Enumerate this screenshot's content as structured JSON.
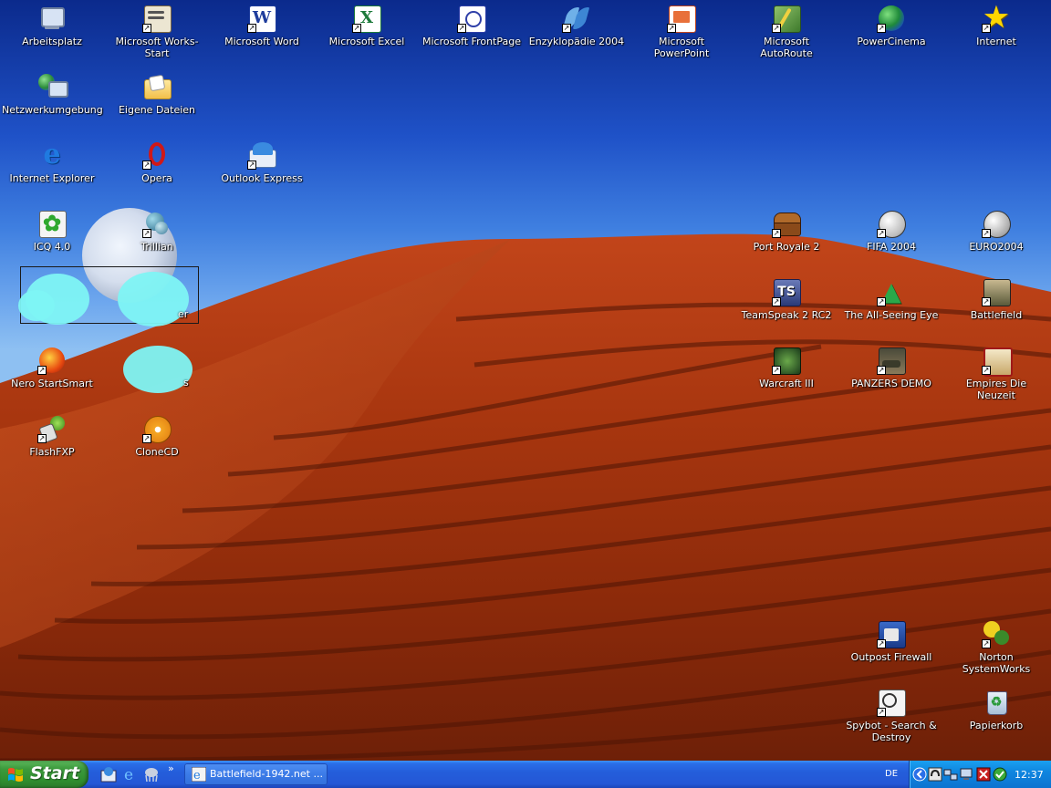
{
  "desktop": {
    "icons": [
      {
        "id": "arbeitsplatz",
        "label": "Arbeitsplatz"
      },
      {
        "id": "works",
        "label": "Microsoft Works-Start"
      },
      {
        "id": "word",
        "label": "Microsoft Word"
      },
      {
        "id": "excel",
        "label": "Microsoft Excel"
      },
      {
        "id": "frontpage",
        "label": "Microsoft FrontPage"
      },
      {
        "id": "enzyklopaedie",
        "label": "Enzyklopädie 2004"
      },
      {
        "id": "powerpoint",
        "label": "Microsoft PowerPoint"
      },
      {
        "id": "autoroute",
        "label": "Microsoft AutoRoute"
      },
      {
        "id": "powercinema",
        "label": "PowerCinema"
      },
      {
        "id": "internet",
        "label": "Internet"
      },
      {
        "id": "netzwerk",
        "label": "Netzwerkumgebung"
      },
      {
        "id": "eigene",
        "label": "Eigene Dateien"
      },
      {
        "id": "ie",
        "label": "Internet Explorer"
      },
      {
        "id": "opera",
        "label": "Opera"
      },
      {
        "id": "outlook",
        "label": "Outlook Express"
      },
      {
        "id": "icq",
        "label": "ICQ 4.0"
      },
      {
        "id": "trillian",
        "label": "Trillian"
      },
      {
        "id": "hidden2",
        "label": "er"
      },
      {
        "id": "nero",
        "label": "Nero StartSmart"
      },
      {
        "id": "hidden3",
        "label": "s"
      },
      {
        "id": "flashfxp",
        "label": "FlashFXP"
      },
      {
        "id": "clonecd",
        "label": "CloneCD"
      },
      {
        "id": "portroyale",
        "label": "Port Royale 2"
      },
      {
        "id": "fifa",
        "label": "FIFA 2004"
      },
      {
        "id": "euro",
        "label": "EURO2004"
      },
      {
        "id": "teamspeak",
        "label": "TeamSpeak 2 RC2"
      },
      {
        "id": "allseeing",
        "label": "The All-Seeing Eye"
      },
      {
        "id": "battlefield",
        "label": "Battlefield"
      },
      {
        "id": "warcraft",
        "label": "Warcraft III"
      },
      {
        "id": "panzers",
        "label": "PANZERS DEMO"
      },
      {
        "id": "empires",
        "label": "Empires Die Neuzeit"
      },
      {
        "id": "outpost",
        "label": "Outpost Firewall"
      },
      {
        "id": "norton",
        "label": "Norton SystemWorks"
      },
      {
        "id": "spybot",
        "label": "Spybot - Search & Destroy"
      },
      {
        "id": "papierkorb",
        "label": "Papierkorb"
      }
    ]
  },
  "taskbar": {
    "start_label": "Start",
    "quick_launch_chevron": "»",
    "task_label": "Battlefield-1942.net ...",
    "language": "DE",
    "clock": "12:37"
  }
}
